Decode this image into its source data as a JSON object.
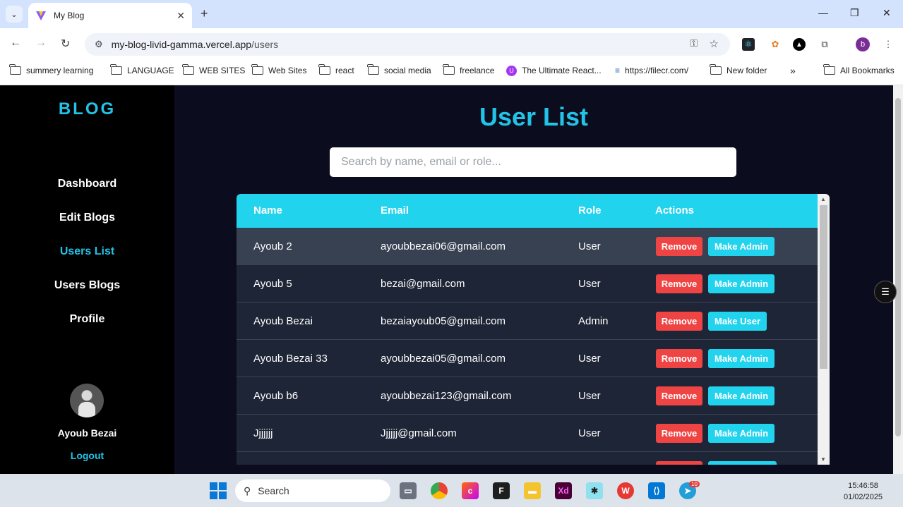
{
  "browser": {
    "tab_title": "My Blog",
    "url_host": "my-blog-livid-gamma.vercel.app",
    "url_path": "/users",
    "profile_initial": "b",
    "bookmarks": [
      {
        "label": "summery learning",
        "icon": "folder-icon"
      },
      {
        "label": "LANGUAGE",
        "icon": "folder-icon"
      },
      {
        "label": "WEB SITES",
        "icon": "folder-icon"
      },
      {
        "label": "Web Sites",
        "icon": "folder-icon"
      },
      {
        "label": "react",
        "icon": "folder-icon"
      },
      {
        "label": "social media",
        "icon": "folder-icon"
      },
      {
        "label": "freelance",
        "icon": "folder-icon"
      },
      {
        "label": "The Ultimate React...",
        "icon": "udemy-icon"
      },
      {
        "label": "https://filecr.com/",
        "icon": "filecr-icon"
      },
      {
        "label": "New folder",
        "icon": "folder-icon"
      },
      {
        "label": "All Bookmarks",
        "icon": "folder-icon"
      }
    ]
  },
  "sidebar": {
    "brand": "BLOG",
    "items": [
      {
        "label": "Dashboard",
        "active": false
      },
      {
        "label": "Edit Blogs",
        "active": false
      },
      {
        "label": "Users List",
        "active": true
      },
      {
        "label": "Users Blogs",
        "active": false
      },
      {
        "label": "Profile",
        "active": false
      }
    ],
    "user_name": "Ayoub Bezai",
    "logout_label": "Logout"
  },
  "main": {
    "title": "User List",
    "search_placeholder": "Search by name, email or role...",
    "columns": [
      "Name",
      "Email",
      "Role",
      "Actions"
    ],
    "remove_label": "Remove",
    "rows": [
      {
        "name": "Ayoub 2",
        "email": "ayoubbezai06@gmail.com",
        "role": "User",
        "action": "Make Admin"
      },
      {
        "name": "Ayoub 5",
        "email": "bezai@gmail.com",
        "role": "User",
        "action": "Make Admin"
      },
      {
        "name": "Ayoub Bezai",
        "email": "bezaiayoub05@gmail.com",
        "role": "Admin",
        "action": "Make User"
      },
      {
        "name": "Ayoub Bezai 33",
        "email": "ayoubbezai05@gmail.com",
        "role": "User",
        "action": "Make Admin"
      },
      {
        "name": "Ayoub b6",
        "email": "ayoubbezai123@gmail.com",
        "role": "User",
        "action": "Make Admin"
      },
      {
        "name": "Jjjjjjj",
        "email": "Jjjjjj@gmail.com",
        "role": "User",
        "action": "Make Admin"
      }
    ]
  },
  "taskbar": {
    "search_label": "Search",
    "time": "15:46:58",
    "date": "01/02/2025",
    "telegram_badge": "10"
  },
  "colors": {
    "accent": "#22c3e6",
    "header": "#22d3ee",
    "danger": "#ef4444"
  }
}
